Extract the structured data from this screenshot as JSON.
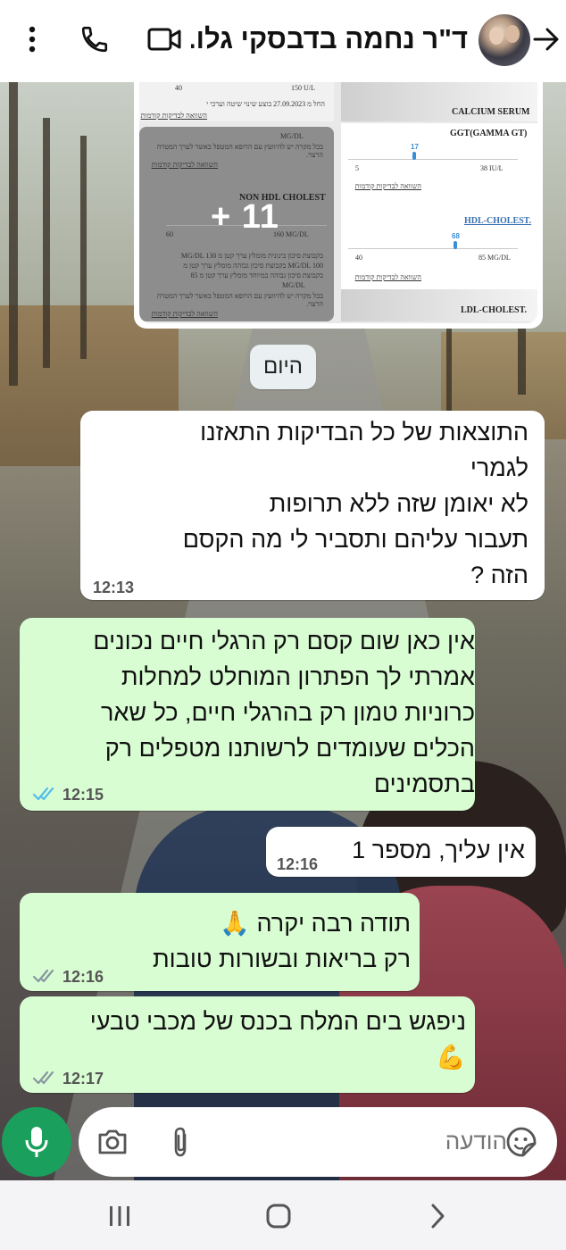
{
  "header": {
    "title": "ד\"ר נחמה בדבסקי גלו...",
    "icons": [
      "more-vert-icon",
      "phone-icon",
      "video-call-icon",
      "back-arrow-icon"
    ]
  },
  "shared_image": {
    "plus_count": "+ 11",
    "left_panel": {
      "top_range_low": "40",
      "top_range_high": "150 U/L",
      "top_note": "החל מ 27.09.2023 בוצע שינוי שיטה וערכי י",
      "top_link": "השוואה לבדיקות קודמות",
      "mgdl_label": "MG/DL",
      "consult_note": "בכל מקרה יש להיוועץ עם הרופא המטפל באשר לערך המטרה הרצוי.",
      "compare_link": "השוואה לבדיקות קודמות",
      "non_hdl_title": "NON HDL CHOLEST",
      "non_hdl_range_low": "60",
      "non_hdl_range_high": "160 MG/DL",
      "risk_line_1": "בקבוצת סיכון בינונית מומלץ ערך קטן מ MG/DL 130",
      "risk_line_2": "MG/DL 100 בקבוצת סיכון גבוהה מומלץ ערך קטן מ",
      "risk_line_3": "בקבוצת סיכון גבוהה במיוחד מומלץ ערך קטן מ 85",
      "risk_line_4": "MG/DL",
      "consult_note_2": "בכל מקרה יש להיוועץ עם הרופא המטפל באשר לערך המטרה הרצוי.",
      "compare_link_2": "השוואה לבדיקות קודמות"
    },
    "right_panel": {
      "calcium_title": "CALCIUM SERUM",
      "ggt_title": "GGT(GAMMA GT)",
      "ggt_value": "17",
      "ggt_range_low": "5",
      "ggt_range_high": "38 IU/L",
      "ggt_link": "השוואה לבדיקות קודמות",
      "hdl_title": "HDL-CHOLEST.",
      "hdl_value": "68",
      "hdl_range_low": "40",
      "hdl_range_high": "85 MG/DL",
      "hdl_link": "השוואה לבדיקות קודמות",
      "ldl_title": "LDL-CHOLEST."
    }
  },
  "date_chip": "היום",
  "messages": [
    {
      "dir": "in",
      "text": "התוצאות של כל  הבדיקות התאזנו\nלגמרי\nלא יאומן שזה ללא תרופות\nתעבור עליהם ותסביר לי מה הקסם\nהזה ?",
      "time": "12:13"
    },
    {
      "dir": "out",
      "text": "אין כאן שום קסם רק הרגלי חיים נכונים\nאמרתי לך הפתרון המוחלט למחלות\nכרוניות טמון רק בהרגלי חיים, כל שאר\nהכלים שעומדים לרשותנו מטפלים רק\nבתסמינים",
      "time": "12:15",
      "status": "read"
    },
    {
      "dir": "in",
      "text": "אין עליך, מספר 1",
      "time": "12:16"
    },
    {
      "dir": "out",
      "text": "תודה רבה יקרה 🙏\nרק בריאות ובשורות טובות",
      "time": "12:16",
      "status": "delivered"
    },
    {
      "dir": "out",
      "text": "ניפגש בים המלח בכנס של מכבי טבעי\n💪",
      "time": "12:17",
      "status": "delivered"
    }
  ],
  "composer": {
    "placeholder": "הודעה",
    "icons": [
      "sticker-icon",
      "attach-icon",
      "camera-icon",
      "mic-icon"
    ]
  },
  "colors": {
    "outgoing_bubble": "#d9fdd3",
    "incoming_bubble": "#ffffff",
    "accent_green": "#1aa05c",
    "read_ticks": "#53bdeb",
    "delivered_ticks": "#8696a0"
  },
  "system_nav": [
    "recents-icon",
    "home-icon",
    "back-icon"
  ]
}
